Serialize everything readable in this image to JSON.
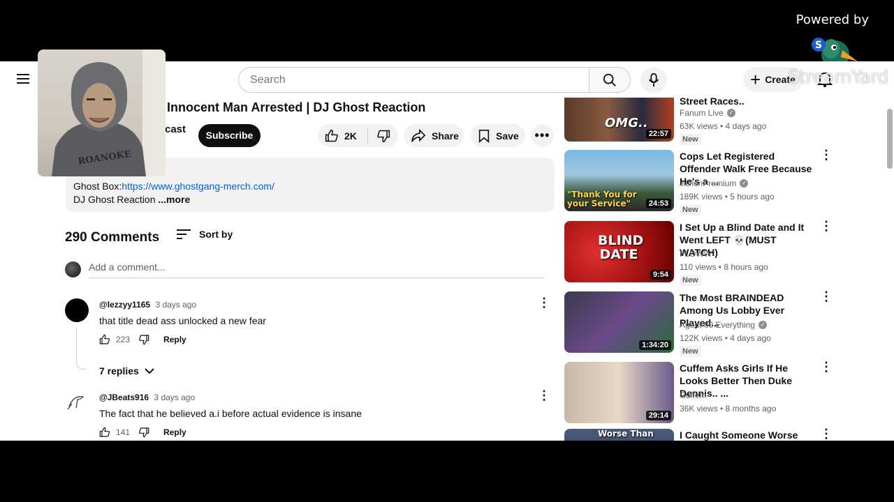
{
  "overlay": {
    "powered_by": "Powered by",
    "watermark": "StreamYard"
  },
  "header": {
    "search_placeholder": "Search",
    "create_label": "Create"
  },
  "video": {
    "title": "Innocent Man Arrested | DJ Ghost Reaction",
    "channel_fragment": "cast",
    "subscribe_label": "Subscribe",
    "likes": "2K",
    "share_label": "Share",
    "save_label": "Save",
    "description": {
      "line1_prefix": "Ghost Box:",
      "line1_link": "https://www.ghostgang-merch.com/",
      "line2": "DJ Ghost Reaction",
      "more_label": " ...more"
    }
  },
  "comments": {
    "count_label": "290 Comments",
    "sort_label": "Sort by",
    "add_placeholder": "Add a comment...",
    "items": [
      {
        "handle": "@lezzyy1165",
        "time": "3 days ago",
        "text": "that title dead ass unlocked a new fear",
        "likes": "223",
        "reply_label": "Reply",
        "replies_label": "7 replies"
      },
      {
        "handle": "@JBeats916",
        "time": "3 days ago",
        "text": "The fact that he believed a.i before actual evidence is insane",
        "likes": "141",
        "reply_label": "Reply"
      }
    ]
  },
  "recommendations": [
    {
      "title": "Street Races..",
      "channel": "Fanum Live",
      "meta": "63K views • 4 days ago",
      "badge": "New",
      "duration": "22:57",
      "thumb_text": "OMG..",
      "verified": true
    },
    {
      "title": "Cops Let Registered Offender Walk Free Because He's a ...",
      "channel": "JiDionPremium",
      "meta": "189K views • 5 hours ago",
      "badge": "New",
      "duration": "24:53",
      "thumb_text": "\"Thank You for your Service\"",
      "verified": true
    },
    {
      "title": "I Set Up a Blind Date and It Went LEFT 💀(MUST WATCH)",
      "channel": "FLOWW",
      "meta": "110 views • 8 hours ago",
      "badge": "New",
      "duration": "9:54",
      "thumb_text": "BLIND DATE",
      "verified": false
    },
    {
      "title": "The Most BRAINDEAD Among Us Lobby Ever Played...",
      "channel": "Agent 00 Everything",
      "meta": "122K views • 4 days ago",
      "badge": "New",
      "duration": "1:34:20",
      "thumb_text": "",
      "verified": true
    },
    {
      "title": "Cuffem Asks Girls If He Looks Better Then Duke Dennis.. ...",
      "channel": "Cuffem",
      "meta": "36K views • 8 months ago",
      "badge": "",
      "duration": "29:14",
      "thumb_text": "",
      "verified": false
    },
    {
      "title": "I Caught Someone Worse Than",
      "channel": "",
      "meta": "",
      "badge": "",
      "duration": "",
      "thumb_text": "Worse Than",
      "verified": false
    }
  ],
  "colors": {
    "link": "#065fd4",
    "accent_dark": "#0f0f0f",
    "muted": "#606060"
  }
}
